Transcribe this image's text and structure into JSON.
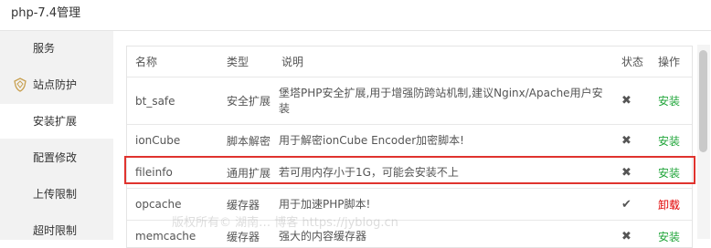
{
  "app": {
    "title": "php-7.4管理"
  },
  "sidebar": {
    "items": [
      {
        "label": "服务",
        "icon": null
      },
      {
        "label": "站点防护",
        "icon": "shield-icon"
      },
      {
        "label": "安装扩展",
        "icon": null,
        "active": true
      },
      {
        "label": "配置修改",
        "icon": null
      },
      {
        "label": "上传限制",
        "icon": null
      },
      {
        "label": "超时限制",
        "icon": null
      }
    ]
  },
  "table": {
    "headers": {
      "name": "名称",
      "type": "类型",
      "desc": "说明",
      "status": "状态",
      "op": "操作"
    },
    "rows": [
      {
        "name": "bt_safe",
        "type": "安全扩展",
        "desc": "堡塔PHP安全扩展,用于增强防跨站机制,建议Nginx/Apache用户安装",
        "status": "✖",
        "op": "安装"
      },
      {
        "name": "ionCube",
        "type": "脚本解密",
        "desc": "用于解密ionCube Encoder加密脚本!",
        "status": "✖",
        "op": "安装"
      },
      {
        "name": "fileinfo",
        "type": "通用扩展",
        "desc": "若可用内存小于1G，可能会安装不上",
        "status": "✖",
        "op": "安装"
      },
      {
        "name": "opcache",
        "type": "缓存器",
        "desc": "用于加速PHP脚本!",
        "status": "✔",
        "op": "卸载"
      },
      {
        "name": "memcache",
        "type": "缓存器",
        "desc": "强大的内容缓存器",
        "status": "✖",
        "op": "安装"
      }
    ]
  },
  "colors": {
    "install": "#20a53a",
    "uninstall": "#e10000",
    "highlight": "#e0332e"
  },
  "watermark": "版权所有© 湖南…  博客 https://jyblog.cn"
}
